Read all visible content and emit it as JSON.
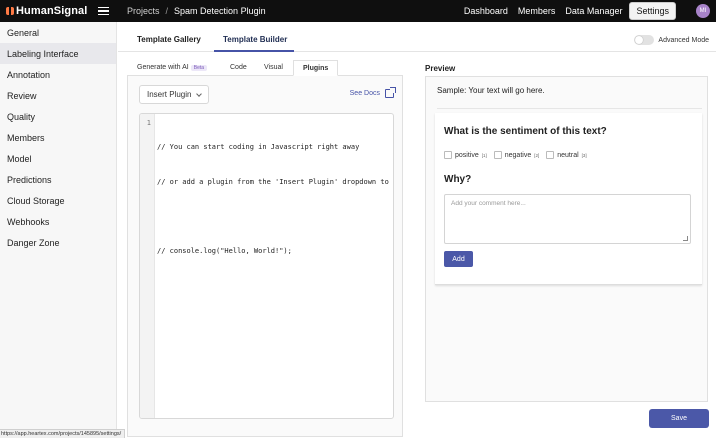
{
  "app": {
    "brand": "HumanSignal",
    "breadcrumb": [
      "Projects",
      "Spam Detection Plugin"
    ]
  },
  "topnav": {
    "items": [
      "Dashboard",
      "Members",
      "Data Manager",
      "Settings"
    ],
    "active": "Settings",
    "avatar_initials": "MI",
    "avatar_color": "#a883c9"
  },
  "sidebar": {
    "items": [
      "General",
      "Labeling Interface",
      "Annotation",
      "Review",
      "Quality",
      "Members",
      "Model",
      "Predictions",
      "Cloud Storage",
      "Webhooks",
      "Danger Zone"
    ],
    "active": "Labeling Interface"
  },
  "config_tabs": {
    "items": [
      "Template Gallery",
      "Template Builder"
    ],
    "active": "Template Builder"
  },
  "advanced_mode": {
    "label": "Advanced Mode",
    "enabled": false
  },
  "builder_tabs": {
    "items": [
      "Generate with AI",
      "Code",
      "Visual",
      "Plugins"
    ],
    "beta_badge": "Beta",
    "active": "Plugins"
  },
  "plugins": {
    "insert_label": "Insert Plugin",
    "see_docs": "See Docs",
    "line_number": "1",
    "code_lines": [
      "// You can start coding in Javascript right away",
      "// or add a plugin from the 'Insert Plugin' dropdown to get",
      "",
      "// console.log(\"Hello, World!\");"
    ]
  },
  "preview": {
    "label": "Preview",
    "sample": "Sample: Your text will go here.",
    "question": "What is the sentiment of this text?",
    "choices": [
      {
        "label": "positive",
        "hotkey": "[1]"
      },
      {
        "label": "negative",
        "hotkey": "[2]"
      },
      {
        "label": "neutral",
        "hotkey": "[3]"
      }
    ],
    "why": "Why?",
    "comment_placeholder": "Add your comment here...",
    "add_label": "Add"
  },
  "save_label": "Save",
  "status_url": "https://app.heartex.com/projects/145895/settings/",
  "colors": {
    "accent": "#4b58a8",
    "topbar": "#0f0f0f",
    "logo": "#ff7a45"
  }
}
